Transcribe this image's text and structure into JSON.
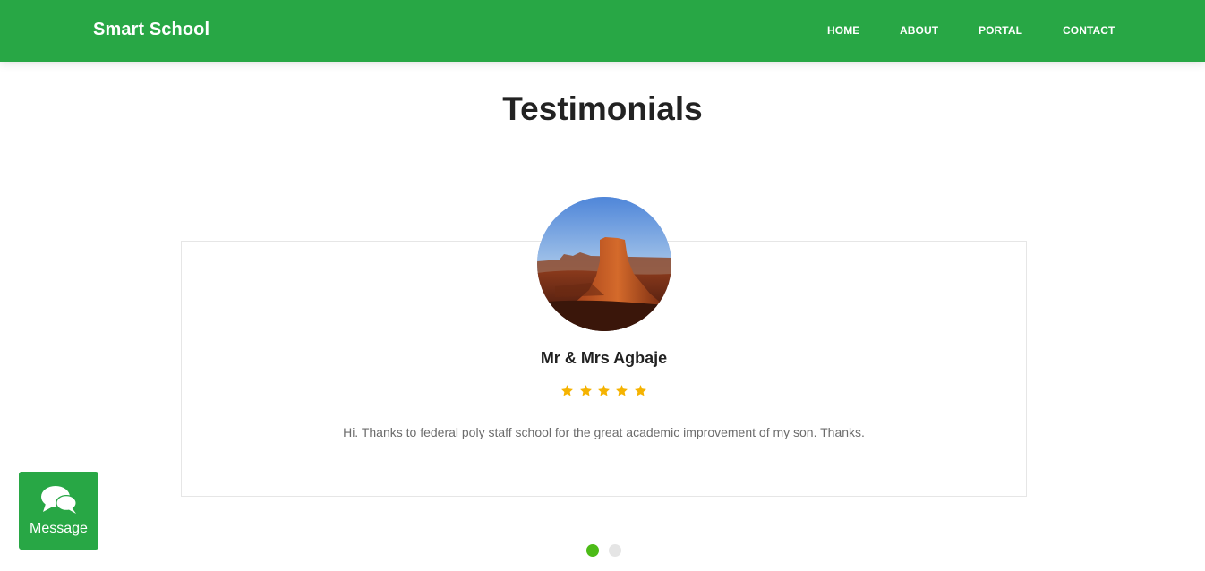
{
  "navbar": {
    "brand": "Smart School",
    "links": [
      "HOME",
      "ABOUT",
      "PORTAL",
      "CONTACT"
    ]
  },
  "section": {
    "title": "Testimonials"
  },
  "testimonial": {
    "name": "Mr & Mrs Agbaje",
    "rating": 5,
    "rating_max": 5,
    "text": "Hi. Thanks to federal poly staff school for the great academic improvement of my son. Thanks."
  },
  "carousel": {
    "slide_count": 2,
    "active_index": 0
  },
  "message_widget": {
    "label": "Message",
    "icon": "chat-bubbles-icon"
  },
  "colors": {
    "primary": "#28a745",
    "star": "#f5b301",
    "active_dot": "#4cbb17",
    "inactive_dot": "#e5e5e5",
    "text_muted": "#6c6c6c"
  }
}
